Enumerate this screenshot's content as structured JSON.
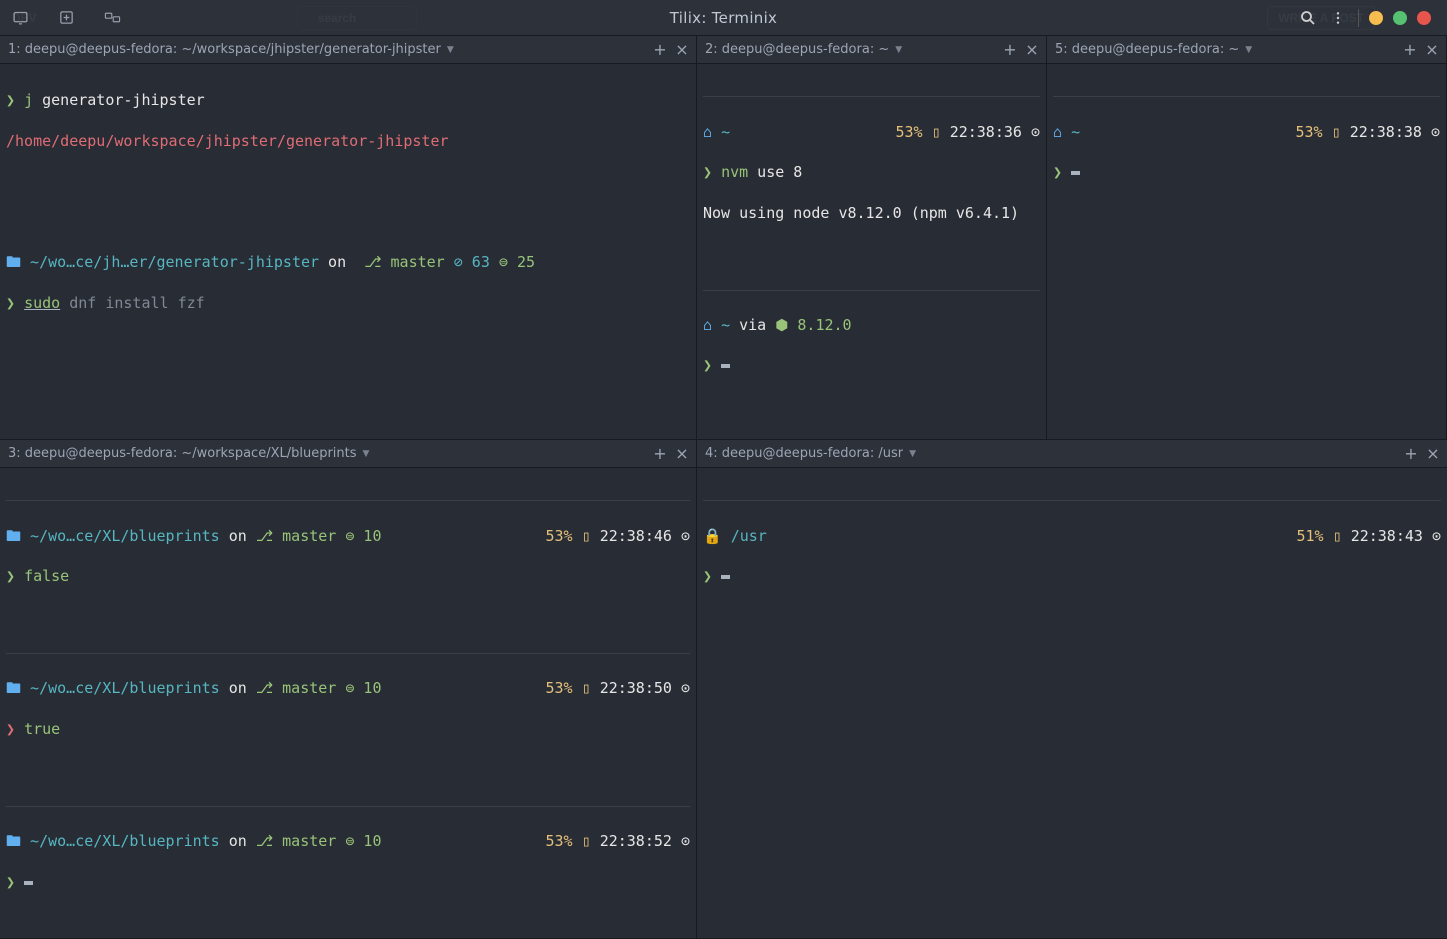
{
  "window": {
    "title": "Tilix: Terminix",
    "bg_dev": "DEV",
    "write_post": "WRITE A POST",
    "search": "search"
  },
  "panes": {
    "p1": {
      "tab": "1: deepu@deepus-fedora: ~/workspace/jhipster/generator-jhipster",
      "cmd1_pre": "j",
      "cmd1_arg": " generator-jhipster",
      "path1": "/home/deepu/workspace/jhipster/generator-jhipster",
      "prompt_dir": "~/wo…ce/jh…er/generator-jhipster",
      "prompt_on": " on ",
      "branch": "master",
      "behind": " 63 ",
      "stash": " 25",
      "cmd2_sudo": "sudo",
      "cmd2_rest": " dnf install fzf"
    },
    "p2": {
      "tab": "2: deepu@deepus-fedora: ~",
      "tilde": "~",
      "pct": "53%",
      "time": "22:38:36",
      "cmd": "nvm",
      "cmd_arg": " use 8",
      "output": "Now using node v8.12.0 (npm v6.4.1)",
      "via": " via ",
      "node_ver": "8.12.0"
    },
    "p5": {
      "tab": "5: deepu@deepus-fedora: ~",
      "tilde": "~",
      "pct": "53%",
      "time": "22:38:38"
    },
    "p3": {
      "tab": "3: deepu@deepus-fedora: ~/workspace/XL/blueprints",
      "dir": "~/wo…ce/XL/blueprints",
      "on": " on ",
      "branch": "master",
      "stash": " 10",
      "pct": "53%",
      "t1": "22:38:46",
      "t2": "22:38:50",
      "t3": "22:38:52",
      "cmd1": "false",
      "cmd2": "true"
    },
    "p4": {
      "tab": "4: deepu@deepus-fedora: /usr",
      "dir": "/usr",
      "pct": "51%",
      "time": "22:38:43"
    }
  },
  "glyph": {
    "prompt": "❯",
    "folder": "🖿",
    "home": "⌂",
    "git": "",
    "branch": "⎇",
    "clock": "⊙",
    "lock": "🔒",
    "pkg": "⬢",
    "behind": "⊘",
    "stash": "⊜",
    "batt": "▯"
  }
}
